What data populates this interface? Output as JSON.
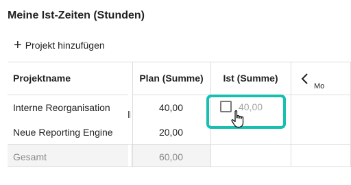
{
  "page": {
    "title": "Meine Ist-Zeiten (Stunden)"
  },
  "toolbar": {
    "add_project_label": "Projekt hinzufügen"
  },
  "table": {
    "headers": {
      "project": "Projektname",
      "plan": "Plan (Summe)",
      "ist": "Ist (Summe)",
      "month_short": "Mo"
    },
    "rows": [
      {
        "project": "Interne Reorganisation",
        "plan": "40,00",
        "ist": "40,00"
      },
      {
        "project": "Neue Reporting Engine",
        "plan": "20,00",
        "ist": ""
      }
    ],
    "total": {
      "label": "Gesamt",
      "plan": "60,00"
    }
  },
  "colors": {
    "highlight": "#17bfb0",
    "muted_text": "#8a8a8a",
    "total_bg": "#f4f4f4",
    "grid_line": "#dcdcdc"
  },
  "icons": {
    "add": "plus-icon",
    "prev_month": "chevron-left-icon",
    "cursor": "hand-pointer-icon",
    "checkbox": "checkbox-unchecked-icon"
  }
}
